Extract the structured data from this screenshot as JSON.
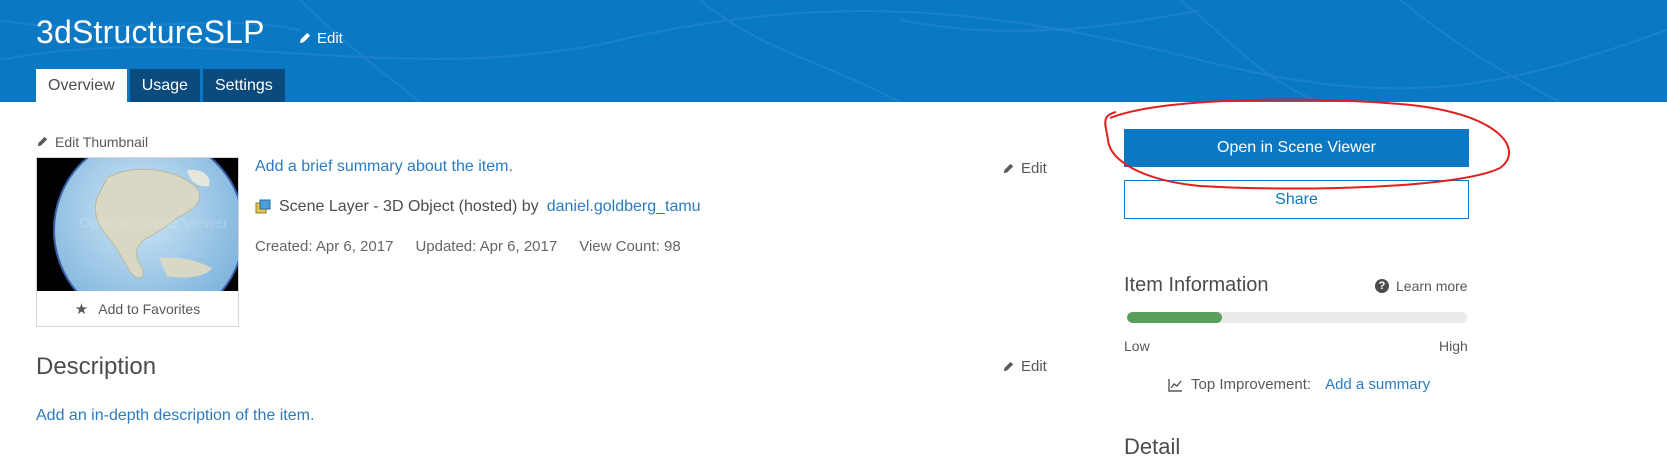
{
  "header": {
    "title": "3dStructureSLP",
    "edit_label": "Edit",
    "tabs": [
      {
        "label": "Overview",
        "active": true
      },
      {
        "label": "Usage",
        "active": false
      },
      {
        "label": "Settings",
        "active": false
      }
    ]
  },
  "thumbnail": {
    "edit_label": "Edit Thumbnail",
    "overlay_text": "Open in Scene Viewer",
    "favorites_label": "Add to Favorites"
  },
  "item": {
    "summary_placeholder": "Add a brief summary about the item.",
    "type_text": "Scene Layer - 3D Object (hosted) by",
    "owner": "daniel.goldberg_tamu",
    "created": "Created: Apr 6, 2017",
    "updated": "Updated: Apr 6, 2017",
    "view_count": "View Count: 98",
    "edit_label": "Edit"
  },
  "description": {
    "title": "Description",
    "edit_label": "Edit",
    "placeholder": "Add an in-depth description of the item."
  },
  "actions": {
    "open_label": "Open in Scene Viewer",
    "share_label": "Share"
  },
  "item_information": {
    "title": "Item Information",
    "learn_more": "Learn more",
    "progress_fraction": 0.28,
    "low_label": "Low",
    "high_label": "High",
    "improvement_label": "Top Improvement:",
    "improvement_link": "Add a summary"
  },
  "details": {
    "title_partial": "Detail"
  },
  "colors": {
    "header_bg": "#0b78c4",
    "tab_bg": "#0a4a7d",
    "link": "#2c7bc0",
    "progress": "#5a9e5c",
    "annotation": "#e0201f"
  },
  "icons": [
    "pencil-icon",
    "star-icon",
    "scene-layer-icon",
    "help-icon",
    "chart-icon"
  ]
}
